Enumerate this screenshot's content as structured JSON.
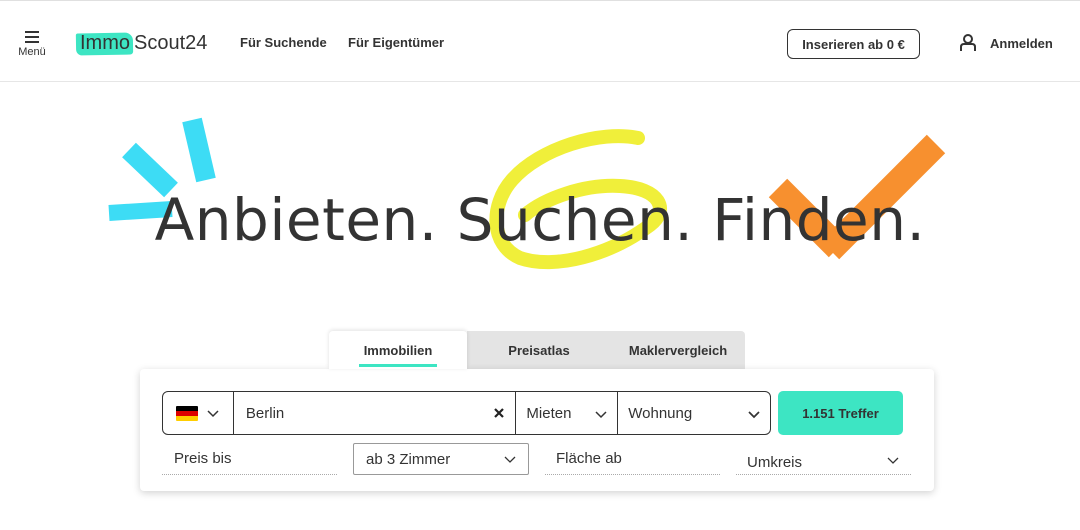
{
  "header": {
    "menu_label": "Menü",
    "logo_part1": "Immo",
    "logo_part2": "Scout24",
    "nav": [
      "Für Suchende",
      "Für Eigentümer"
    ],
    "insert_button": "Inserieren ab 0 €",
    "login_label": "Anmelden"
  },
  "hero": {
    "words": [
      "Anbieten.",
      "Suchen.",
      "Finden."
    ]
  },
  "tabs": [
    {
      "label": "Immobilien",
      "active": true
    },
    {
      "label": "Preisatlas",
      "active": false
    },
    {
      "label": "Maklervergleich",
      "active": false
    }
  ],
  "search": {
    "country_flag": "germany-flag-icon",
    "location_value": "Berlin",
    "offer_type": "Mieten",
    "property_type": "Wohnung",
    "results_button": "1.151 Treffer"
  },
  "filters": {
    "price": "Preis bis",
    "rooms": "ab 3 Zimmer",
    "area": "Fläche ab",
    "radius": "Umkreis"
  },
  "colors": {
    "accent": "#3de5c3",
    "deco_cyan": "#3ddcf5",
    "deco_yellow": "#f0ef3a",
    "deco_orange": "#f7902f",
    "text": "#333333"
  }
}
